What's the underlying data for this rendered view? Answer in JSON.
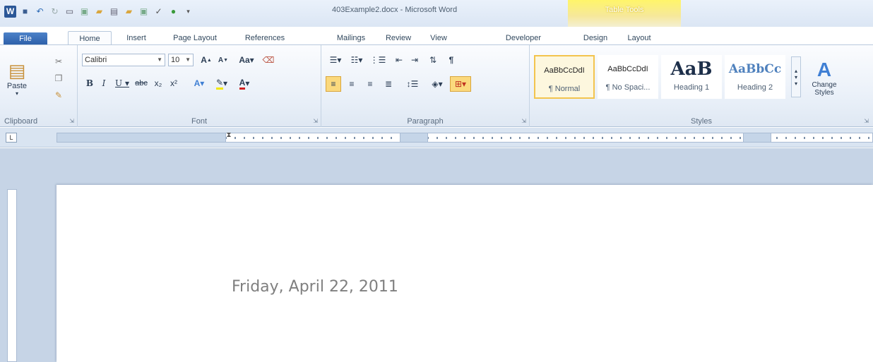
{
  "window": {
    "title": "403Example2.docx - Microsoft Word",
    "context_tab": "Table Tools"
  },
  "tabs": [
    "File",
    "Home",
    "Insert",
    "Page Layout",
    "References",
    "Mailings",
    "Review",
    "View",
    "Developer",
    "Design",
    "Layout"
  ],
  "clipboard": {
    "paste": "Paste",
    "label": "Clipboard"
  },
  "font": {
    "name": "Calibri",
    "size": "10",
    "label": "Font"
  },
  "paragraph": {
    "label": "Paragraph"
  },
  "styles": {
    "label": "Styles",
    "items": [
      {
        "preview": "AaBbCcDdI",
        "name": "¶ Normal"
      },
      {
        "preview": "AaBbCcDdI",
        "name": "¶ No Spaci..."
      },
      {
        "preview": "AaB",
        "name": "Heading 1"
      },
      {
        "preview": "AaBbCc",
        "name": "Heading 2"
      }
    ],
    "change_styles": "Change Styles"
  },
  "document": {
    "text": "Friday, April 22, 2011"
  },
  "icons": [
    "word-logo-icon",
    "save-icon",
    "undo-icon",
    "paste-icon",
    "bold-icon",
    "italic-icon",
    "underline-icon",
    "bullets-icon",
    "numbering-icon",
    "align-left-icon",
    "shading-icon",
    "borders-icon",
    "pilcrow-icon"
  ]
}
